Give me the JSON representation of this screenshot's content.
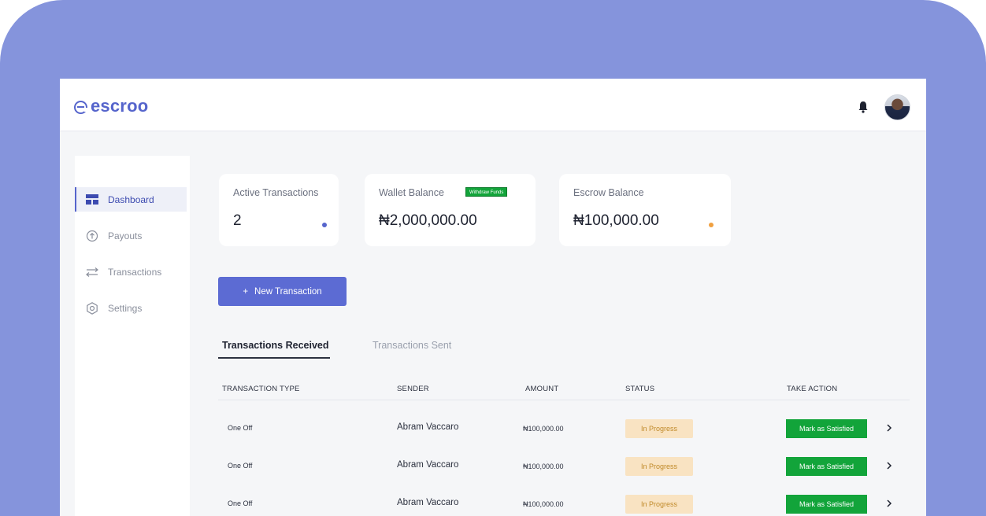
{
  "app": {
    "logo_text": "escroo"
  },
  "sidebar": {
    "items": [
      {
        "label": "Dashboard",
        "icon": "dashboard-icon",
        "active": true
      },
      {
        "label": "Payouts",
        "icon": "arrow-up-circle-icon",
        "active": false
      },
      {
        "label": "Transactions",
        "icon": "swap-arrows-icon",
        "active": false
      },
      {
        "label": "Settings",
        "icon": "gear-icon",
        "active": false
      }
    ]
  },
  "cards": [
    {
      "label": "Active Transactions",
      "value": "2",
      "dot_color": "#5665cc"
    },
    {
      "label": "Wallet Balance",
      "value": "₦2,000,000.00",
      "button": "Withdraw Funds"
    },
    {
      "label": "Escrow Balance",
      "value": "₦100,000.00",
      "dot_color": "#f0a040"
    }
  ],
  "new_transaction_button": {
    "icon": "+",
    "label": "New Transaction"
  },
  "tabs": [
    {
      "label": "Transactions Received",
      "active": true
    },
    {
      "label": "Transactions Sent",
      "active": false
    }
  ],
  "table": {
    "columns": [
      "TRANSACTION TYPE",
      "SENDER",
      "AMOUNT",
      "STATUS",
      "TAKE ACTION"
    ],
    "rows": [
      {
        "type": "One Off",
        "sender": "Abram Vaccaro",
        "amount": "₦100,000.00",
        "status": "In Progress",
        "action": "Mark as Satisfied"
      },
      {
        "type": "One Off",
        "sender": "Abram Vaccaro",
        "amount": "₦100,000.00",
        "status": "In Progress",
        "action": "Mark as Satisfied"
      },
      {
        "type": "One Off",
        "sender": "Abram Vaccaro",
        "amount": "₦100,000.00",
        "status": "In Progress",
        "action": "Mark as Satisfied"
      }
    ]
  },
  "colors": {
    "frame_bg": "#8594dc",
    "brand": "#5665cc",
    "success": "#12a43a",
    "pending_bg": "#f9e3c2"
  }
}
